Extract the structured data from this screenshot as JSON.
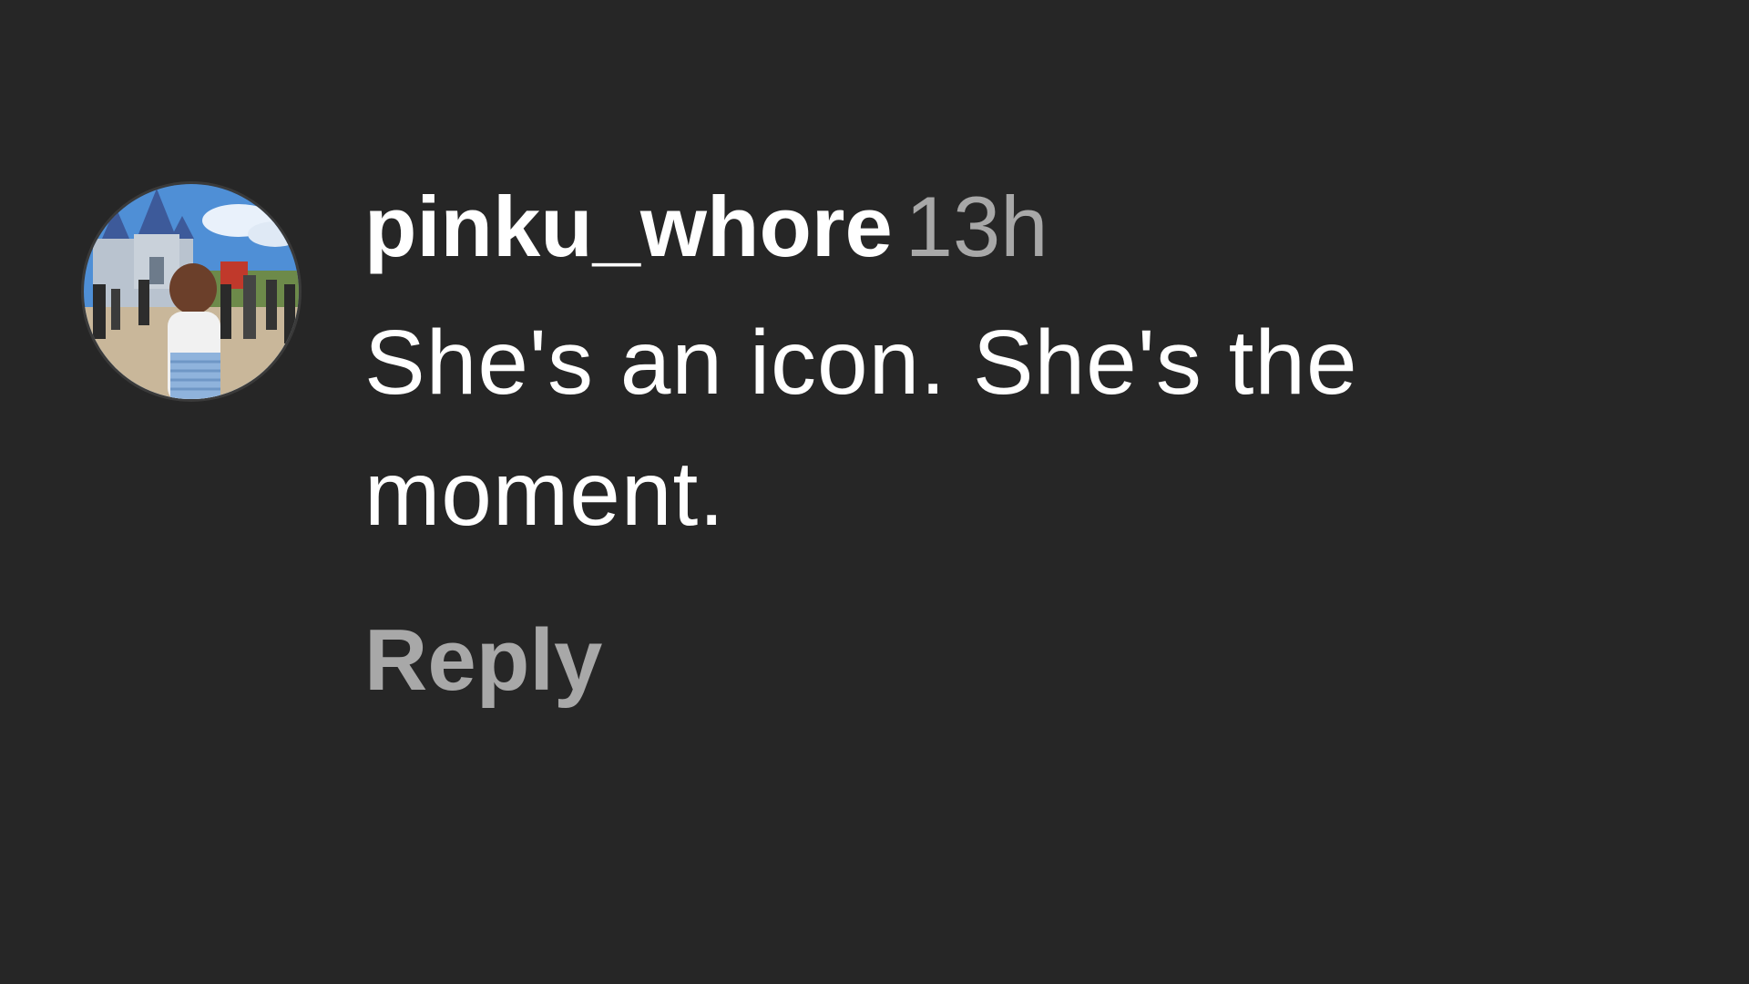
{
  "comment": {
    "username": "pinku_whore",
    "timestamp": "13h",
    "text": "She's an icon. She's the moment.",
    "reply_label": "Reply",
    "avatar_icon": "profile-photo-castle-crowd"
  },
  "colors": {
    "background": "#262626",
    "username": "#ffffff",
    "text": "#ffffff",
    "muted": "#a8a8a8"
  }
}
